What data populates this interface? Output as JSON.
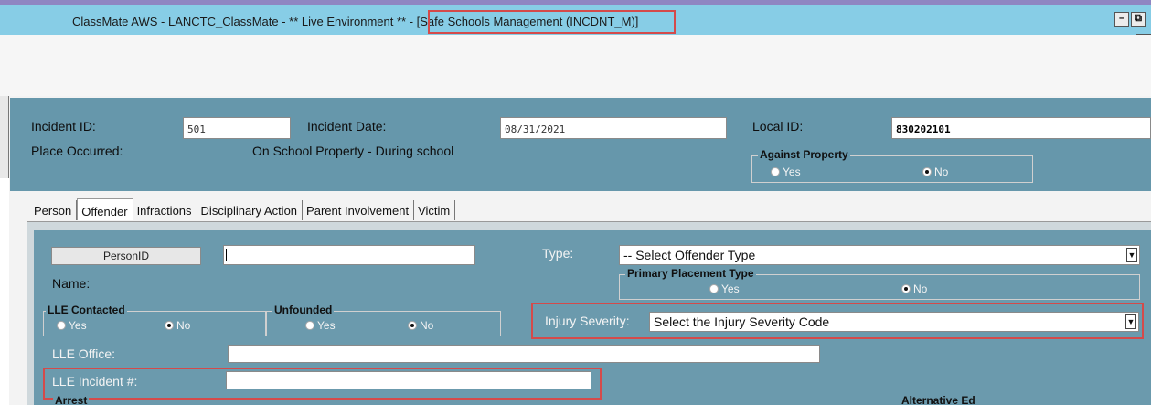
{
  "window": {
    "title": "ClassMate AWS - LANCTC_ClassMate - ** Live Environment ** - [Safe Schools Management (INCDNT_M)]",
    "minimize_glyph": "–",
    "restore_glyph": "⧉",
    "sub_restore_glyph": "–"
  },
  "header": {
    "incident_id_label": "Incident ID:",
    "incident_id_value": "501",
    "incident_date_label": "Incident Date:",
    "incident_date_value": "08/31/2021",
    "local_id_label": "Local ID:",
    "local_id_value": "830202101",
    "place_label": "Place Occurred:",
    "place_value": "On School Property - During school",
    "against_property": {
      "title": "Against Property",
      "yes": "Yes",
      "no": "No",
      "selected": "No"
    }
  },
  "tabs": [
    {
      "label": "Person"
    },
    {
      "label": "Offender"
    },
    {
      "label": "Infractions"
    },
    {
      "label": "Disciplinary Action"
    },
    {
      "label": "Parent Involvement"
    },
    {
      "label": "Victim"
    }
  ],
  "active_tab": "Offender",
  "offender": {
    "person_id_button": "PersonID",
    "person_id_value": "",
    "name_label": "Name:",
    "type_label": "Type:",
    "type_value": "-- Select Offender Type",
    "primary_placement": {
      "title": "Primary Placement Type",
      "yes": "Yes",
      "no": "No",
      "selected": "No"
    },
    "lle_contacted": {
      "title": "LLE Contacted",
      "yes": "Yes",
      "no": "No",
      "selected": "No"
    },
    "unfounded": {
      "title": "Unfounded",
      "yes": "Yes",
      "no": "No",
      "selected": "No"
    },
    "injury_severity_label": "Injury Severity:",
    "injury_severity_value": "Select the Injury Severity Code",
    "lle_office_label": "LLE Office:",
    "lle_office_value": "",
    "lle_incident_label": "LLE Incident #:",
    "lle_incident_value": "",
    "arrest_title": "Arrest",
    "alternative_ed_title": "Alternative Ed"
  },
  "colors": {
    "title_accent": "#87cde6",
    "panel": "#6697ab",
    "highlight": "#d44a4a"
  }
}
